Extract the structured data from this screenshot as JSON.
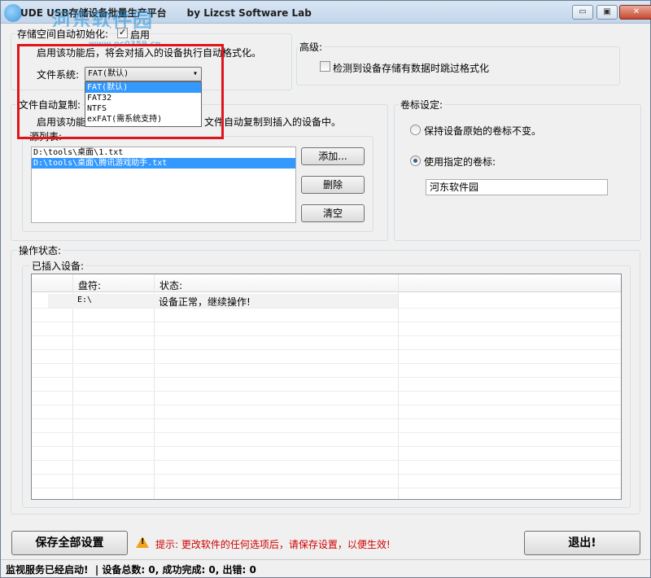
{
  "window": {
    "title": "UDE USB存储设备批量生产平台      by Lizcst Software Lab",
    "controls": {
      "minimize": "▭",
      "maximize": "▣",
      "close": "✕"
    },
    "watermark": {
      "text": "河东软件园",
      "url": "www.pc0359.cn"
    }
  },
  "format": {
    "group_label": "存储空间自动初始化:",
    "enable_label": "启用",
    "enable_checked": true,
    "description": "启用该功能后，将会对插入的设备执行自动格式化。",
    "fs_label": "文件系统:",
    "fs_selected": "FAT(默认)",
    "fs_options": [
      "FAT(默认)",
      "FAT32",
      "NTFS",
      "exFAT(需系统支持)"
    ]
  },
  "advanced": {
    "group_label": "高级:",
    "skip_label": "检测到设备存储有数据时跳过格式化",
    "skip_checked": false
  },
  "copy": {
    "group_label": "文件自动复制:",
    "description_left": "启用该功能",
    "description_right": "文件自动复制到插入的设备中。",
    "source_label": "源列表:",
    "files": [
      "D:\\tools\\桌面\\1.txt",
      "D:\\tools\\桌面\\腾讯游戏助手.txt"
    ],
    "selected_index": 1,
    "add_button": "添加...",
    "delete_button": "删除",
    "clear_button": "清空"
  },
  "volume": {
    "group_label": "卷标设定:",
    "keep_label": "保持设备原始的卷标不变。",
    "custom_label": "使用指定的卷标:",
    "custom_selected": true,
    "value": "河东软件园"
  },
  "operation": {
    "group_label": "操作状态:",
    "devices_label": "已插入设备:",
    "columns": [
      "",
      "盘符:",
      "状态:",
      ""
    ],
    "rows": [
      {
        "drive": "E:\\",
        "status": "设备正常，继续操作!"
      }
    ]
  },
  "footer": {
    "save_button": "保存全部设置",
    "warning_icon": "warning-icon",
    "hint": "提示: 更改软件的任何选项后，请保存设置，以便生效!",
    "exit_button": "退出!",
    "status_text": "监视服务已经启动!  | 设备总数: 0, 成功完成: 0, 出错: 0"
  },
  "colors": {
    "accent_red": "#e0151b",
    "hint_red": "#d00000",
    "selection_blue": "#3399ff"
  }
}
